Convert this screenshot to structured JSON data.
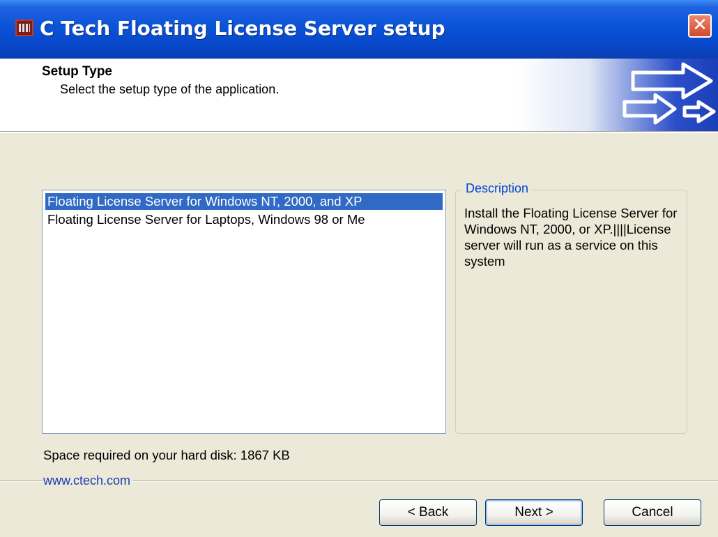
{
  "window": {
    "title": "C Tech Floating License Server setup",
    "close_glyph": "✕"
  },
  "header": {
    "title": "Setup Type",
    "subtitle": "Select the setup type of the application."
  },
  "setup_list": {
    "items": [
      {
        "label": "Floating License Server for Windows NT, 2000, and XP",
        "selected": true
      },
      {
        "label": "Floating License Server for Laptops, Windows 98 or Me",
        "selected": false
      }
    ]
  },
  "description": {
    "legend": "Description",
    "text": "Install the Floating License Server for Windows NT, 2000, or XP.||||License server will run as a service on this system"
  },
  "space_required": "Space required on your hard disk: 1867 KB",
  "brand_link": "www.ctech.com",
  "buttons": {
    "back": "< Back",
    "next": "Next >",
    "cancel": "Cancel"
  },
  "icons": {
    "app": "app-icon",
    "close": "close-icon",
    "banner": "arrows-icon"
  },
  "colors": {
    "titlebar": "#0a53d8",
    "selection": "#316ac5",
    "link": "#1a3fb4",
    "group_legend": "#0046d5"
  }
}
